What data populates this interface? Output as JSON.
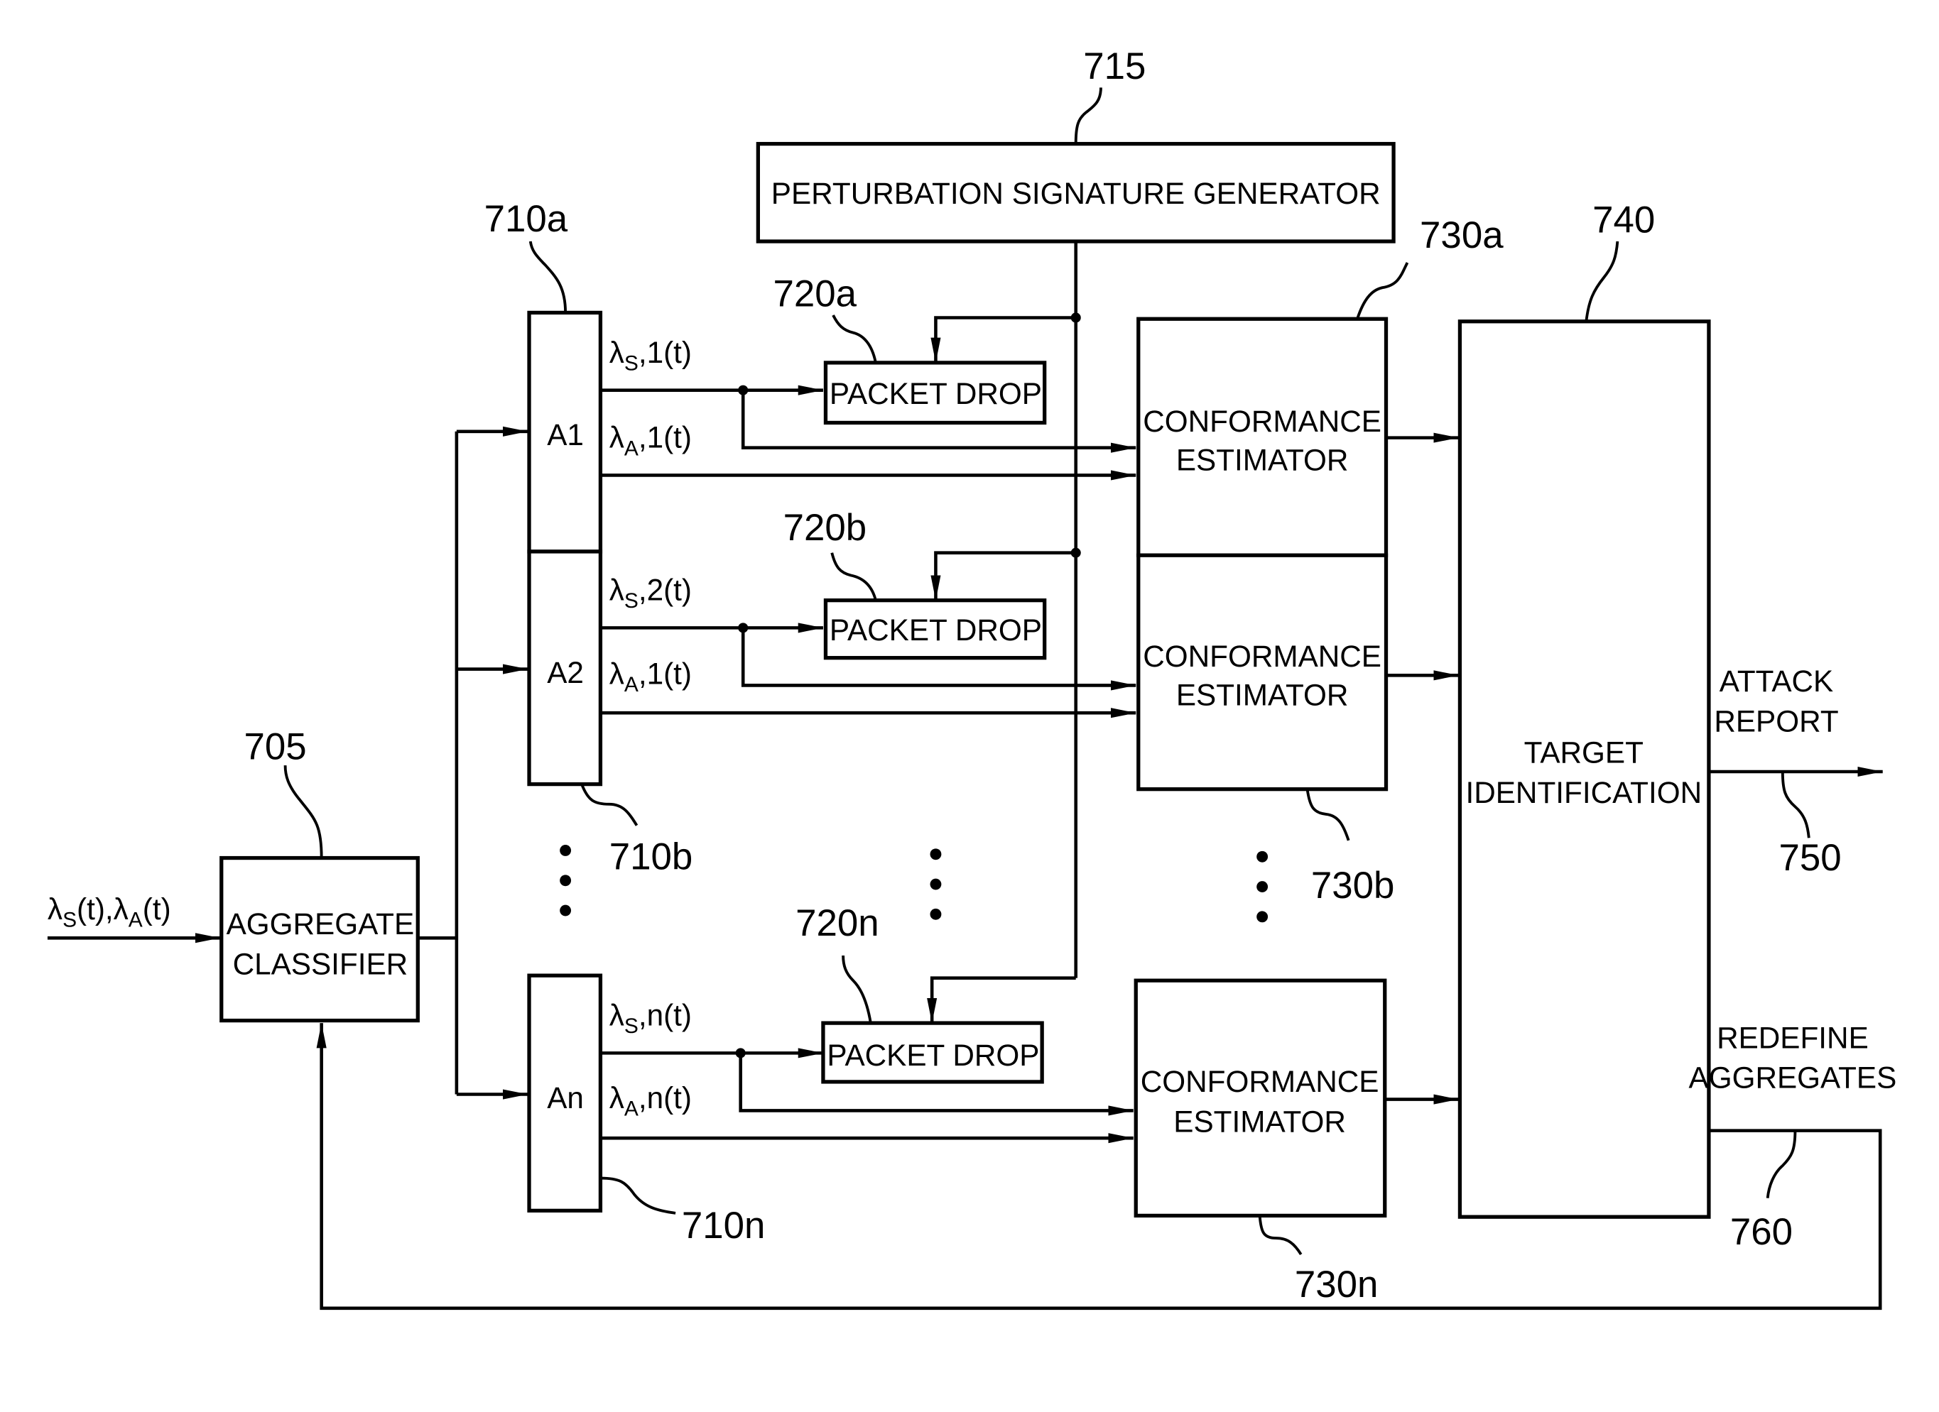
{
  "figure": {
    "input_signal": {
      "lambda": "λ",
      "sub_s": "S",
      "mid": "(t),",
      "sub_a": "A",
      "end": "(t)"
    },
    "blocks": {
      "psg": {
        "label": "PERTURBATION SIGNATURE GENERATOR",
        "ref": "715"
      },
      "classifier": {
        "line1": "AGGREGATE",
        "line2": "CLASSIFIER",
        "ref": "705"
      },
      "aggregates": [
        {
          "label": "A1",
          "ref": "710a"
        },
        {
          "label": "A2",
          "ref": "710b"
        },
        {
          "label": "An",
          "ref": "710n"
        }
      ],
      "packet_drops": [
        {
          "label": "PACKET DROP",
          "ref": "720a"
        },
        {
          "label": "PACKET DROP",
          "ref": "720b"
        },
        {
          "label": "PACKET DROP",
          "ref": "720n"
        }
      ],
      "estimators": [
        {
          "line1": "CONFORMANCE",
          "line2": "ESTIMATOR",
          "ref": "730a"
        },
        {
          "line1": "CONFORMANCE",
          "line2": "ESTIMATOR",
          "ref": "730b"
        },
        {
          "line1": "CONFORMANCE",
          "line2": "ESTIMATOR",
          "ref": "730n"
        }
      ],
      "target": {
        "line1": "TARGET",
        "line2": "IDENTIFICATION",
        "ref": "740"
      }
    },
    "signals": [
      {
        "s_idx": "1",
        "a_idx": "1"
      },
      {
        "s_idx": "2",
        "a_idx": "1"
      },
      {
        "s_idx": "n",
        "a_idx": "n"
      }
    ],
    "signal_parts": {
      "lambda": "λ",
      "sub_s": "S",
      "sub_a": "A",
      "comma": ",",
      "tail": "(t)"
    },
    "outputs": {
      "attack": {
        "line1": "ATTACK",
        "line2": "REPORT",
        "ref": "750"
      },
      "redefine": {
        "line1": "REDEFINE",
        "line2": "AGGREGATES",
        "ref": "760"
      }
    }
  }
}
